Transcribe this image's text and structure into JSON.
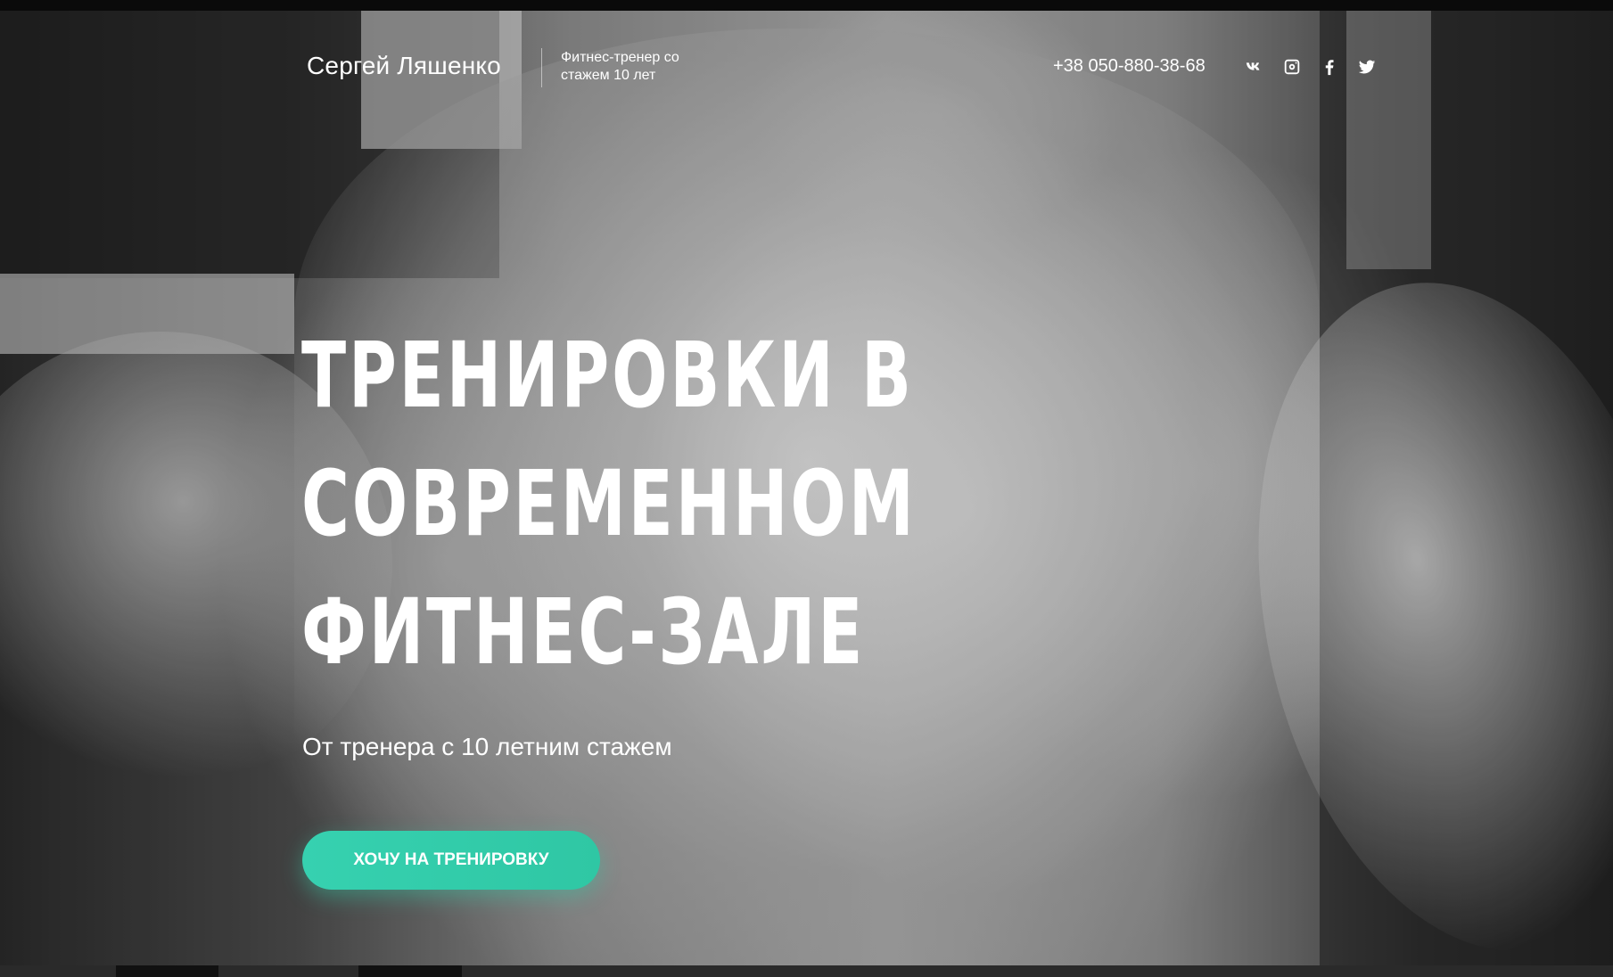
{
  "header": {
    "brand_name": "Сергей Ляшенко",
    "tagline": "Фитнес-тренер со стажем 10 лет",
    "phone": "+38 050-880-38-68",
    "socials": [
      {
        "name": "vk-icon"
      },
      {
        "name": "instagram-icon"
      },
      {
        "name": "facebook-icon"
      },
      {
        "name": "twitter-icon"
      }
    ]
  },
  "hero": {
    "headline_lines": [
      "ТРЕНИРОВКИ В",
      "СОВРЕМЕННОМ",
      "ФИТНЕС-ЗАЛЕ"
    ],
    "subtitle": "От тренера с 10 летним стажем",
    "cta_label": "ХОЧУ НА ТРЕНИРОВКУ",
    "cta_color": "#36d1b0"
  }
}
